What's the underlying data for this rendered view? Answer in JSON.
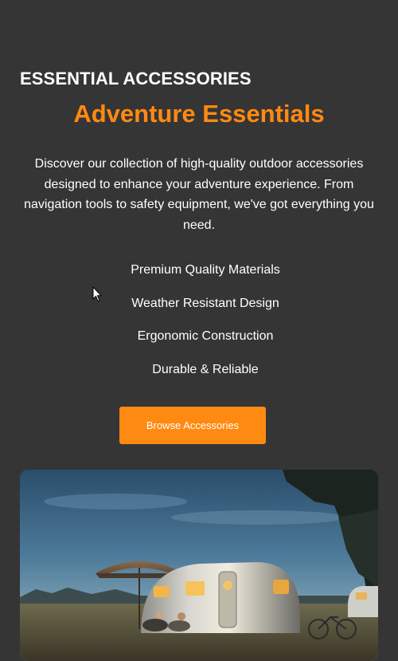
{
  "section": {
    "eyebrow": "ESSENTIAL ACCESSORIES",
    "headline": "Adventure Essentials",
    "intro": "Discover our collection of high-quality outdoor accessories designed to enhance your adventure experience. From navigation tools to safety equipment, we've got everything you need.",
    "features": [
      "Premium Quality Materials",
      "Weather Resistant Design",
      "Ergonomic Construction",
      "Durable & Reliable"
    ],
    "cta_label": "Browse Accessories"
  },
  "photo": {
    "subject": "vintage-airstream-trailer-campsite-at-dusk"
  },
  "colors": {
    "background": "#353535",
    "accent": "#ff8a12",
    "text": "#ffffff"
  }
}
